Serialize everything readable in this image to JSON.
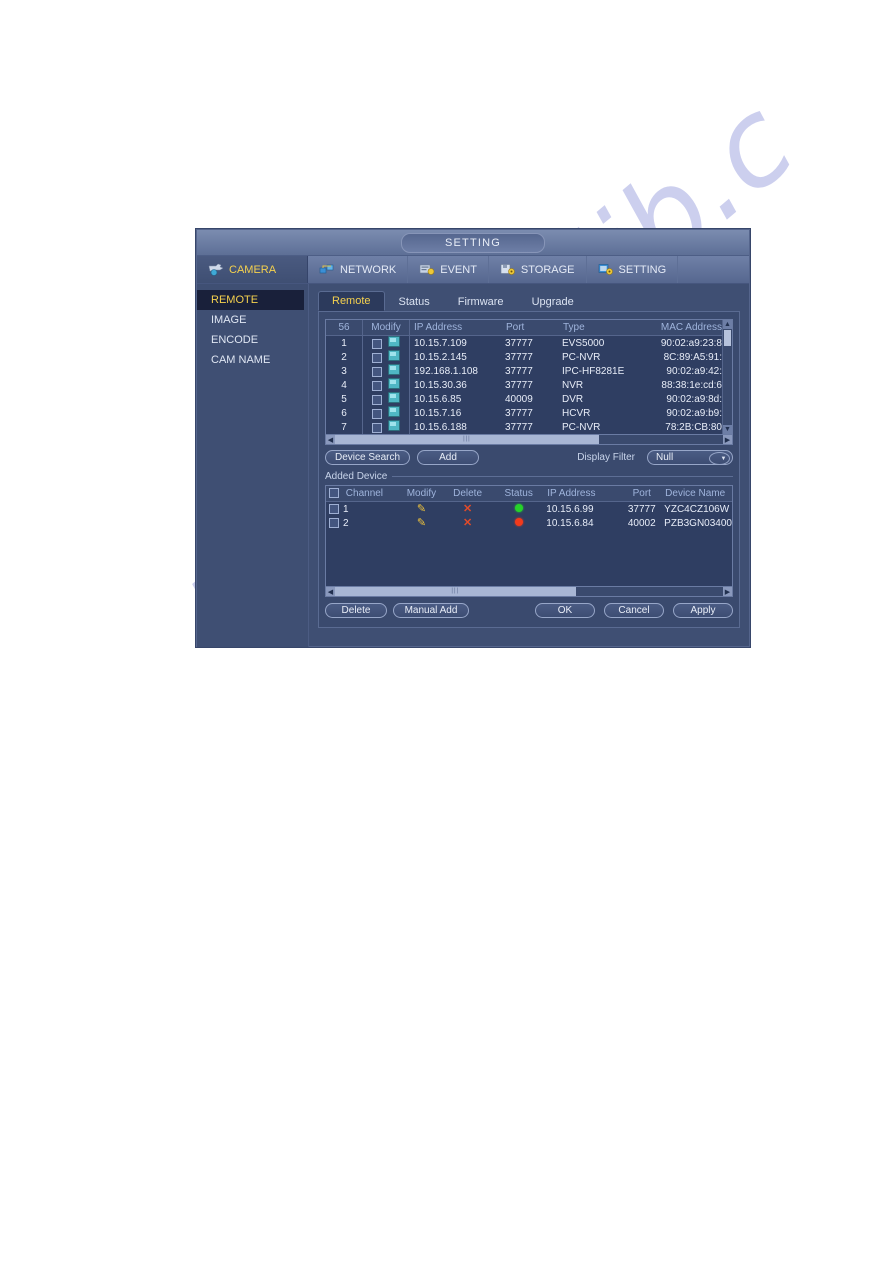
{
  "watermark": "manualslib.c",
  "window": {
    "title": "SETTING"
  },
  "topnav": [
    {
      "label": "CAMERA",
      "icon": "camera-icon",
      "active": true
    },
    {
      "label": "NETWORK",
      "icon": "network-icon",
      "active": false
    },
    {
      "label": "EVENT",
      "icon": "event-icon",
      "active": false
    },
    {
      "label": "STORAGE",
      "icon": "storage-icon",
      "active": false
    },
    {
      "label": "SETTING",
      "icon": "setting-icon",
      "active": false
    }
  ],
  "sidebar": {
    "items": [
      {
        "label": "REMOTE",
        "active": true
      },
      {
        "label": "IMAGE",
        "active": false
      },
      {
        "label": "ENCODE",
        "active": false
      },
      {
        "label": "CAM NAME",
        "active": false
      }
    ]
  },
  "tabs": [
    {
      "label": "Remote",
      "active": true
    },
    {
      "label": "Status",
      "active": false
    },
    {
      "label": "Firmware",
      "active": false
    },
    {
      "label": "Upgrade",
      "active": false
    }
  ],
  "device_table": {
    "count_header": "56",
    "headers": [
      "56",
      "Modify",
      "IP Address",
      "Port",
      "Type",
      "MAC Address"
    ],
    "rows": [
      {
        "no": "1",
        "ip": "10.15.7.109",
        "port": "37777",
        "type": "EVS5000",
        "mac": "90:02:a9:23:8"
      },
      {
        "no": "2",
        "ip": "10.15.2.145",
        "port": "37777",
        "type": "PC-NVR",
        "mac": "8C:89:A5:91:"
      },
      {
        "no": "3",
        "ip": "192.168.1.108",
        "port": "37777",
        "type": "IPC-HF8281E",
        "mac": "90:02:a9:42:"
      },
      {
        "no": "4",
        "ip": "10.15.30.36",
        "port": "37777",
        "type": "NVR",
        "mac": "88:38:1e:cd:6"
      },
      {
        "no": "5",
        "ip": "10.15.6.85",
        "port": "40009",
        "type": "DVR",
        "mac": "90:02:a9:8d:"
      },
      {
        "no": "6",
        "ip": "10.15.7.16",
        "port": "37777",
        "type": "HCVR",
        "mac": "90:02:a9:b9:"
      },
      {
        "no": "7",
        "ip": "10.15.6.188",
        "port": "37777",
        "type": "PC-NVR",
        "mac": "78:2B:CB:80"
      }
    ]
  },
  "actions": {
    "device_search": "Device Search",
    "add": "Add",
    "display_filter_label": "Display Filter",
    "display_filter_value": "Null"
  },
  "added_device": {
    "group_title": "Added Device",
    "headers": [
      "Channel",
      "Modify",
      "Delete",
      "Status",
      "IP Address",
      "Port",
      "Device Name"
    ],
    "rows": [
      {
        "channel": "1",
        "status": "online",
        "ip": "10.15.6.99",
        "port": "37777",
        "name": "YZC4CZ106W"
      },
      {
        "channel": "2",
        "status": "offline",
        "ip": "10.15.6.84",
        "port": "40002",
        "name": "PZB3GN03400"
      }
    ]
  },
  "footer": {
    "delete": "Delete",
    "manual_add": "Manual Add",
    "ok": "OK",
    "cancel": "Cancel",
    "apply": "Apply"
  },
  "colors": {
    "accent_yellow": "#f5d14e",
    "status_online": "#26d22a",
    "status_offline": "#f23a1c",
    "panel_bg": "#3a4a6e"
  }
}
